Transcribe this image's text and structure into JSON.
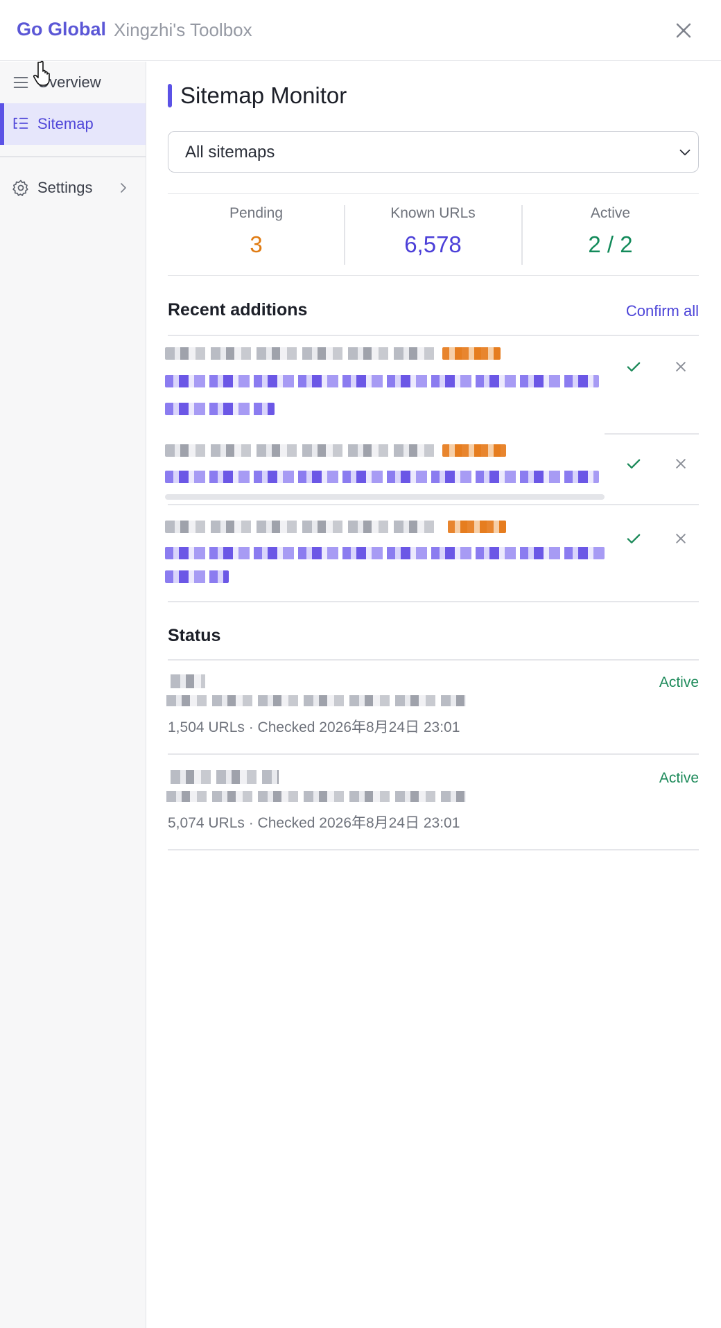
{
  "header": {
    "brand": "Go Global",
    "subtitle": "Xingzhi's Toolbox"
  },
  "sidebar": {
    "items": [
      {
        "label": "Overview",
        "icon": "menu-icon",
        "active": false
      },
      {
        "label": "Sitemap",
        "icon": "list-tree-icon",
        "active": true
      },
      {
        "label": "Settings",
        "icon": "gear-icon",
        "active": false
      }
    ]
  },
  "main": {
    "title": "Sitemap Monitor",
    "select": {
      "value": "All sitemaps"
    },
    "stats": [
      {
        "label": "Pending",
        "value": "3",
        "color": "#e07b12"
      },
      {
        "label": "Known URLs",
        "value": "6,578",
        "color": "#4b3fd8"
      },
      {
        "label": "Active",
        "value": "2 / 2",
        "color": "#128a5a"
      }
    ],
    "recent": {
      "heading": "Recent additions",
      "confirm_all": "Confirm all"
    },
    "status": {
      "heading": "Status",
      "items": [
        {
          "badge": "Active",
          "meta": "1,504 URLs · Checked 2026年8月24日 23:01"
        },
        {
          "badge": "Active",
          "meta": "5,074 URLs · Checked 2026年8月24日 23:01"
        }
      ]
    }
  },
  "colors": {
    "accent": "#5b52e6",
    "success": "#1d8a5a",
    "warning": "#e07b12"
  }
}
